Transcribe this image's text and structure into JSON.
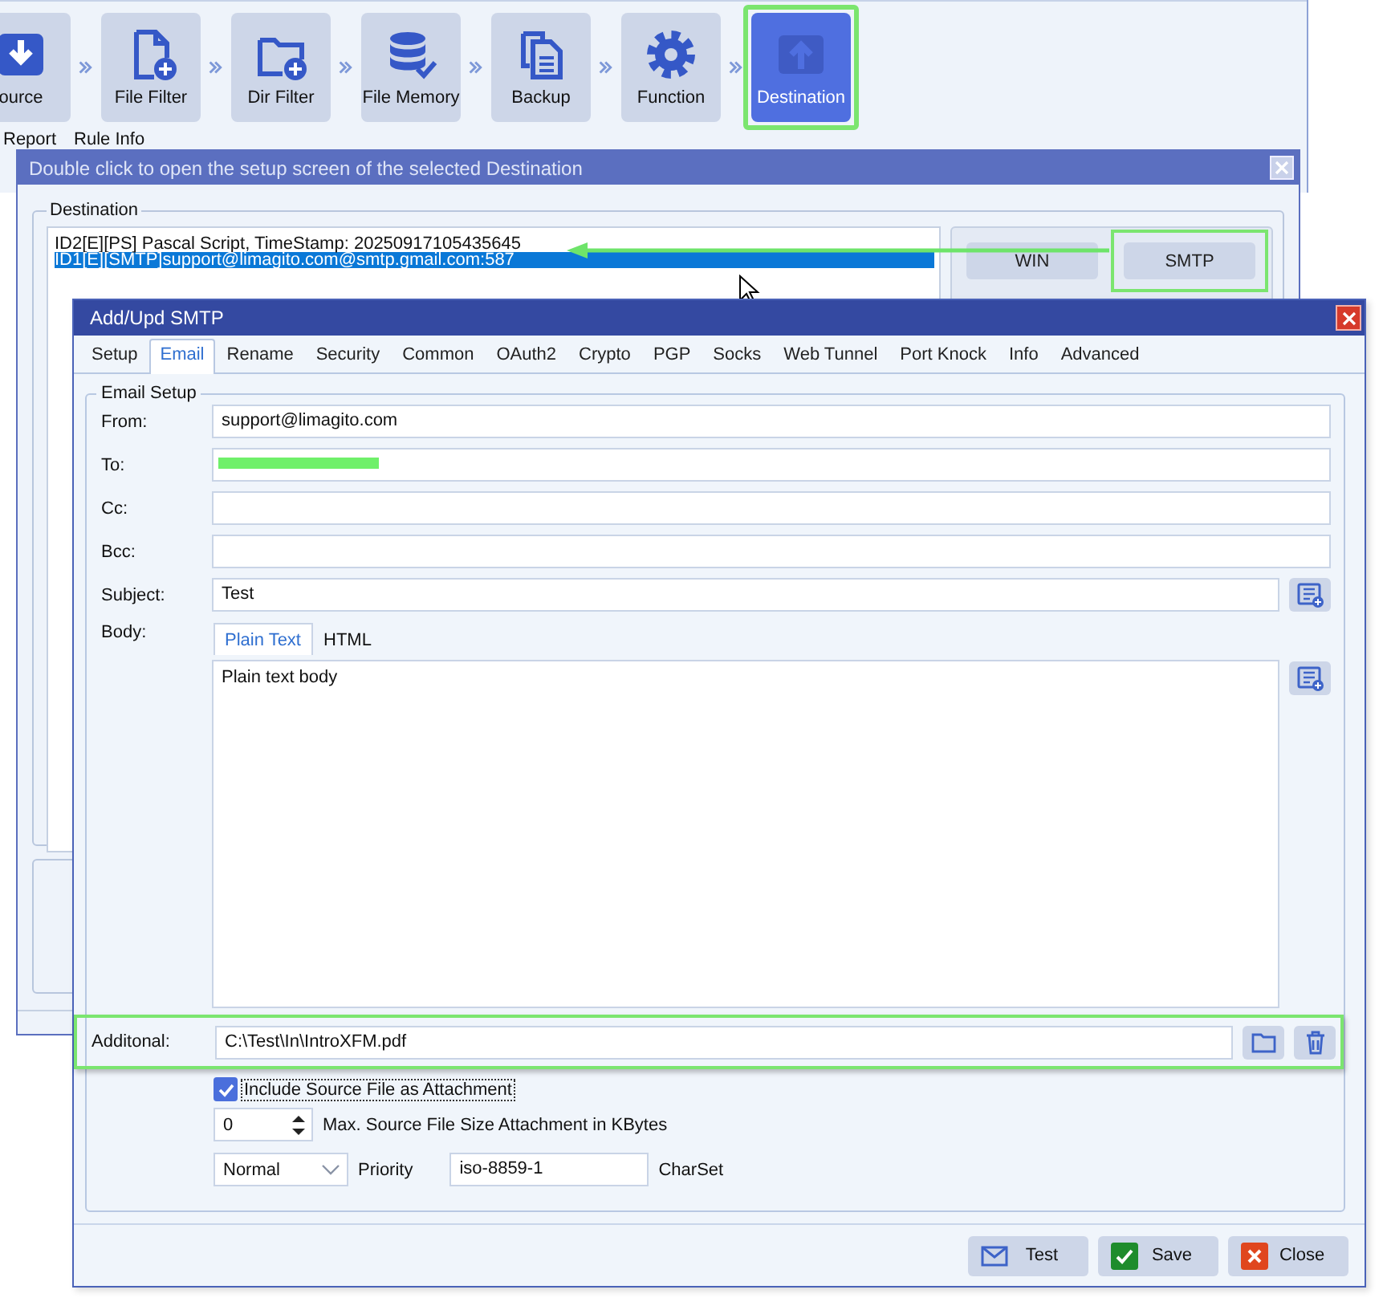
{
  "toolbar": {
    "steps": [
      {
        "label": "ource",
        "selected": false,
        "highlighted": false
      },
      {
        "label": "File Filter",
        "selected": false,
        "highlighted": false
      },
      {
        "label": "Dir Filter",
        "selected": false,
        "highlighted": false
      },
      {
        "label": "File Memory",
        "selected": false,
        "highlighted": false
      },
      {
        "label": "Backup",
        "selected": false,
        "highlighted": false
      },
      {
        "label": "Function",
        "selected": false,
        "highlighted": false
      },
      {
        "label": "Destination",
        "selected": true,
        "highlighted": true
      }
    ],
    "tabs": [
      "Report",
      "Rule Info"
    ]
  },
  "destination_window": {
    "title": "Double click to open the setup screen of the selected Destination",
    "group_label": "Destination",
    "items": [
      {
        "text": "ID2[E][PS] Pascal Script, TimeStamp: 20250917105435645",
        "selected": false
      },
      {
        "text": "ID1[E][SMTP]support@limagito.com@smtp.gmail.com:587",
        "selected": true
      }
    ],
    "buttons": [
      {
        "label": "WIN",
        "highlighted": false
      },
      {
        "label": "SMTP",
        "highlighted": true
      }
    ]
  },
  "smtp_window": {
    "title": "Add/Upd SMTP",
    "tabs": [
      {
        "label": "Setup",
        "selected": false
      },
      {
        "label": "Email",
        "selected": true
      },
      {
        "label": "Rename",
        "selected": false
      },
      {
        "label": "Security",
        "selected": false
      },
      {
        "label": "Common",
        "selected": false
      },
      {
        "label": "OAuth2",
        "selected": false
      },
      {
        "label": "Crypto",
        "selected": false
      },
      {
        "label": "PGP",
        "selected": false
      },
      {
        "label": "Socks",
        "selected": false
      },
      {
        "label": "Web Tunnel",
        "selected": false
      },
      {
        "label": "Port Knock",
        "selected": false
      },
      {
        "label": "Info",
        "selected": false
      },
      {
        "label": "Advanced",
        "selected": false
      }
    ],
    "group_label": "Email Setup",
    "fields": [
      {
        "label": "From:",
        "value": "support@limagito.com",
        "redacted": false,
        "list_button": false
      },
      {
        "label": "To:",
        "redacted": true,
        "list_button": false
      },
      {
        "label": "Cc:",
        "redacted": false,
        "list_button": false
      },
      {
        "label": "Bcc:",
        "redacted": false,
        "list_button": false
      },
      {
        "label": "Subject:",
        "value": "Test",
        "redacted": false,
        "list_button": true
      }
    ],
    "body": {
      "label": "Body:",
      "tabs": [
        {
          "label": "Plain Text",
          "selected": true
        },
        {
          "label": "HTML",
          "selected": false
        }
      ],
      "value": "Plain text body"
    },
    "additional": {
      "label": "Additonal:",
      "value": "C:\\Test\\In\\IntroXFM.pdf",
      "highlighted": true
    },
    "attachment": {
      "label": "Include Source File as Attachment",
      "checked": true
    },
    "max_size": {
      "value": "0",
      "label": "Max. Source File Size Attachment in KBytes"
    },
    "priority": {
      "value": "Normal",
      "label": "Priority"
    },
    "charset": {
      "value": "iso-8859-1",
      "label": "CharSet"
    },
    "buttons": [
      {
        "label": "Test",
        "kind": "mail"
      },
      {
        "label": "Save",
        "kind": "check"
      },
      {
        "label": "Close",
        "kind": "close"
      }
    ]
  }
}
